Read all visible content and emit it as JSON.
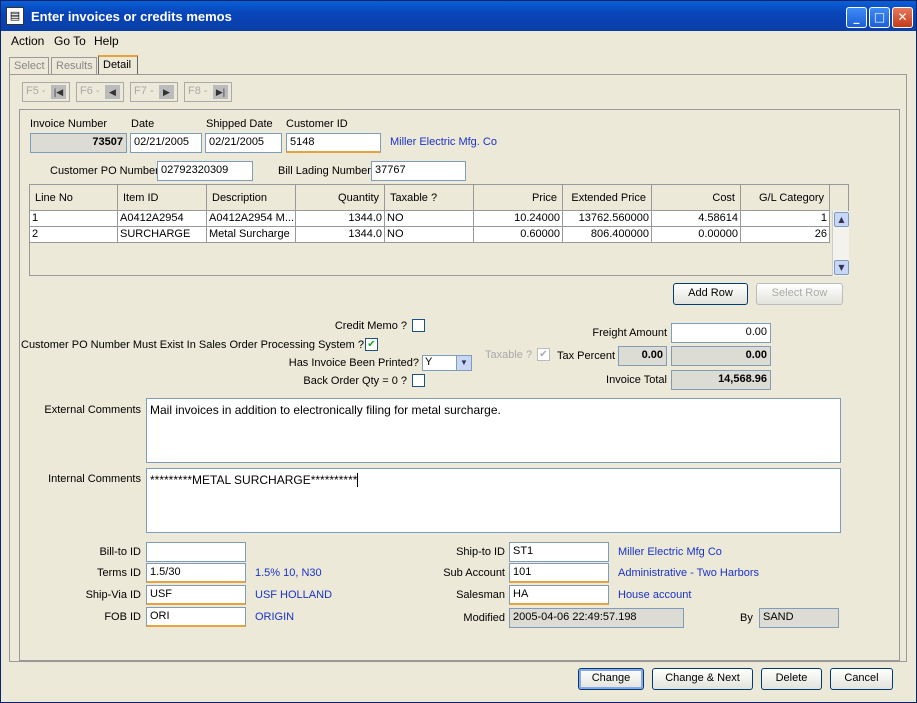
{
  "window": {
    "title": "Enter invoices or credits memos",
    "icon": "app-icon"
  },
  "menu": [
    "Action",
    "Go To",
    "Help"
  ],
  "tabs": [
    "Select",
    "Results",
    "Detail"
  ],
  "nav": [
    "F5 -",
    "F6 -",
    "F7 -",
    "F8 -"
  ],
  "header": {
    "invoice_number_label": "Invoice Number",
    "invoice_number": "73507",
    "date_label": "Date",
    "date": "02/21/2005",
    "shipped_date_label": "Shipped Date",
    "shipped_date": "02/21/2005",
    "customer_id_label": "Customer ID",
    "customer_id": "5148",
    "customer_name": "Miller Electric Mfg. Co",
    "customer_po_label": "Customer PO Number",
    "customer_po": "02792320309",
    "bill_lading_label": "Bill Lading Number",
    "bill_lading": "37767"
  },
  "grid": {
    "columns": [
      "Line No",
      "Item ID",
      "Description",
      "Quantity",
      "Taxable ?",
      "Price",
      "Extended Price",
      "Cost",
      "G/L Category"
    ],
    "rows": [
      [
        "1",
        "A0412A2954",
        "A0412A2954 M...",
        "1344.0",
        "NO",
        "10.24000",
        "13762.560000",
        "4.58614",
        "1"
      ],
      [
        "2",
        "SURCHARGE",
        "Metal Surcharge",
        "1344.0",
        "NO",
        "0.60000",
        "806.400000",
        "0.00000",
        "26"
      ]
    ]
  },
  "buttons": {
    "add_row": "Add Row",
    "select_row": "Select Row",
    "change": "Change",
    "change_next": "Change & Next",
    "delete": "Delete",
    "cancel": "Cancel"
  },
  "options": {
    "credit_memo_label": "Credit Memo ?",
    "credit_memo": false,
    "po_must_exist_label": "Customer PO Number Must Exist In Sales Order Processing System ?",
    "po_must_exist": true,
    "printed_label": "Has Invoice Been Printed?",
    "printed": "Y",
    "back_order_label": "Back Order Qty = 0 ?",
    "back_order": false,
    "taxable_label": "Taxable ?"
  },
  "totals": {
    "freight_label": "Freight Amount",
    "freight": "0.00",
    "tax_percent_label": "Tax Percent",
    "tax_percent": "0.00",
    "tax_amount": "0.00",
    "invoice_total_label": "Invoice Total",
    "invoice_total": "14,568.96"
  },
  "comments": {
    "external_label": "External Comments",
    "external": "Mail invoices in addition to electronically filing for metal surcharge.",
    "internal_label": "Internal Comments",
    "internal": "*********METAL SURCHARGE**********"
  },
  "footer": {
    "bill_to_label": "Bill-to ID",
    "bill_to": "",
    "terms_label": "Terms ID",
    "terms": "1.5/30",
    "terms_desc": "1.5% 10, N30",
    "ship_via_label": "Ship-Via ID",
    "ship_via": "USF",
    "ship_via_desc": "USF HOLLAND",
    "fob_label": "FOB ID",
    "fob": "ORI",
    "fob_desc": "ORIGIN",
    "ship_to_label": "Ship-to ID",
    "ship_to": "ST1",
    "ship_to_desc": "Miller Electric Mfg Co",
    "sub_account_label": "Sub Account",
    "sub_account": "101",
    "sub_account_desc": "Administrative - Two Harbors",
    "salesman_label": "Salesman",
    "salesman": "HA",
    "salesman_desc": "House account",
    "modified_label": "Modified",
    "modified": "2005-04-06 22:49:57.198",
    "by_label": "By",
    "by": "SAND"
  }
}
